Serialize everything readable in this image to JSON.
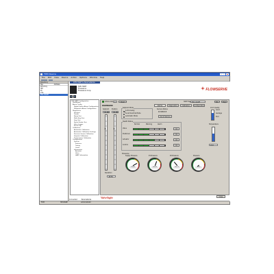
{
  "window": {
    "title": "FDM Device"
  },
  "menu": [
    "File",
    "Edit",
    "View",
    "Device",
    "Action",
    "Options",
    "Window",
    "Help"
  ],
  "left_pane": {
    "header": "Directory",
    "columns": [
      "Tag",
      "Address"
    ],
    "rows": [
      {
        "label": "Directory",
        "selected": false
      },
      {
        "label": "HM",
        "selected": false
      },
      {
        "label": "PC",
        "selected": false
      },
      {
        "label": "V1A",
        "selected": false
      },
      {
        "label": "DV1-VALVE",
        "selected": true
      }
    ]
  },
  "right_pane": {
    "tab_label": "DTM HART & Parameterize",
    "device_lines": [
      "DVR HART",
      "Flowserve",
      "Flowserve Corp."
    ],
    "logo": "FLOWSERVE",
    "tree": [
      "DVR HART Configuration",
      "Dashboard",
      "Alarm Config",
      "Digital Status Alarm Configuration",
      "Diagnostic Alarm Configuration",
      "Diagnostics",
      "Versions",
      "Trends",
      "Ramp Test",
      "Multi-Step Test",
      "Step Test",
      "Partial Stroke Test",
      "Valve Logger",
      "Event Log",
      "Calibration",
      "Automatic Calibration",
      "Automatic Calibration Settings",
      "Pressure Sensor Calibration",
      "Setpoint Calibration",
      "Temperature Calibration",
      "Configuration",
      "System",
      "Features",
      "Tuning",
      "Limits",
      "Information",
      "Actuator",
      "Valve",
      "HART Information"
    ],
    "panel": {
      "status_label": "Active Alarms",
      "status_value": "0",
      "clear_label": "Clear",
      "hart_tag_label": "HART Tag",
      "hart_tag_value": "DV1-VALVE",
      "small_btn_1": "NA",
      "small_btn_2": "Help",
      "section_title": "DASHBOARD",
      "nav_buttons": [
        "Alarms",
        "Diagnostics",
        "Calibration",
        "Configuration"
      ],
      "setpoint_label": "Setpoint",
      "setpoint_value": "74.0%",
      "position_label": "Position",
      "position_value": "74.0%",
      "deviation_label": "Deviation",
      "deviation_value": "-0.1%",
      "setpoint_mode_label": "Setpoint Mode",
      "setpoint_modes": [
        "4-20 Analog",
        "Local Override Mode",
        "Automatic Mode"
      ],
      "service_status_label": "Service Status",
      "service_status_value": "IN SERVICE",
      "out_of_service_label": "Out of Service",
      "health_status_label": "Health Status",
      "health_columns": [
        "Normal",
        "Warning",
        "Alarm"
      ],
      "health_rows": [
        {
          "label": "Valve",
          "info": "Info"
        },
        {
          "label": "Positioner",
          "info": "Info"
        },
        {
          "label": "Actuator",
          "info": "Info"
        },
        {
          "label": "Control",
          "info": "Info"
        }
      ],
      "signal_quality_label": "Cmd Quality",
      "signal_quality_items": [
        "Good",
        "Average",
        "Poor"
      ],
      "temperature_label": "Temperature",
      "temperature_value": "24.0",
      "pressures_label": "Pressures",
      "gauges": [
        {
          "label": "Supply Pressure",
          "value": "74.00"
        },
        {
          "label": "P1 Pressure",
          "value": "54.03"
        },
        {
          "label": "P2 Pressure",
          "value": "26.13"
        },
        {
          "label": "Pressure",
          "value": "0.00"
        }
      ]
    },
    "brand": "ValveSight",
    "close_label": "Close"
  },
  "bottom_tabs": [
    "Connected",
    "Parameterize"
  ],
  "statusbar": {
    "left": "FDM",
    "right": "HDSHARE",
    "center": "Administrator"
  }
}
